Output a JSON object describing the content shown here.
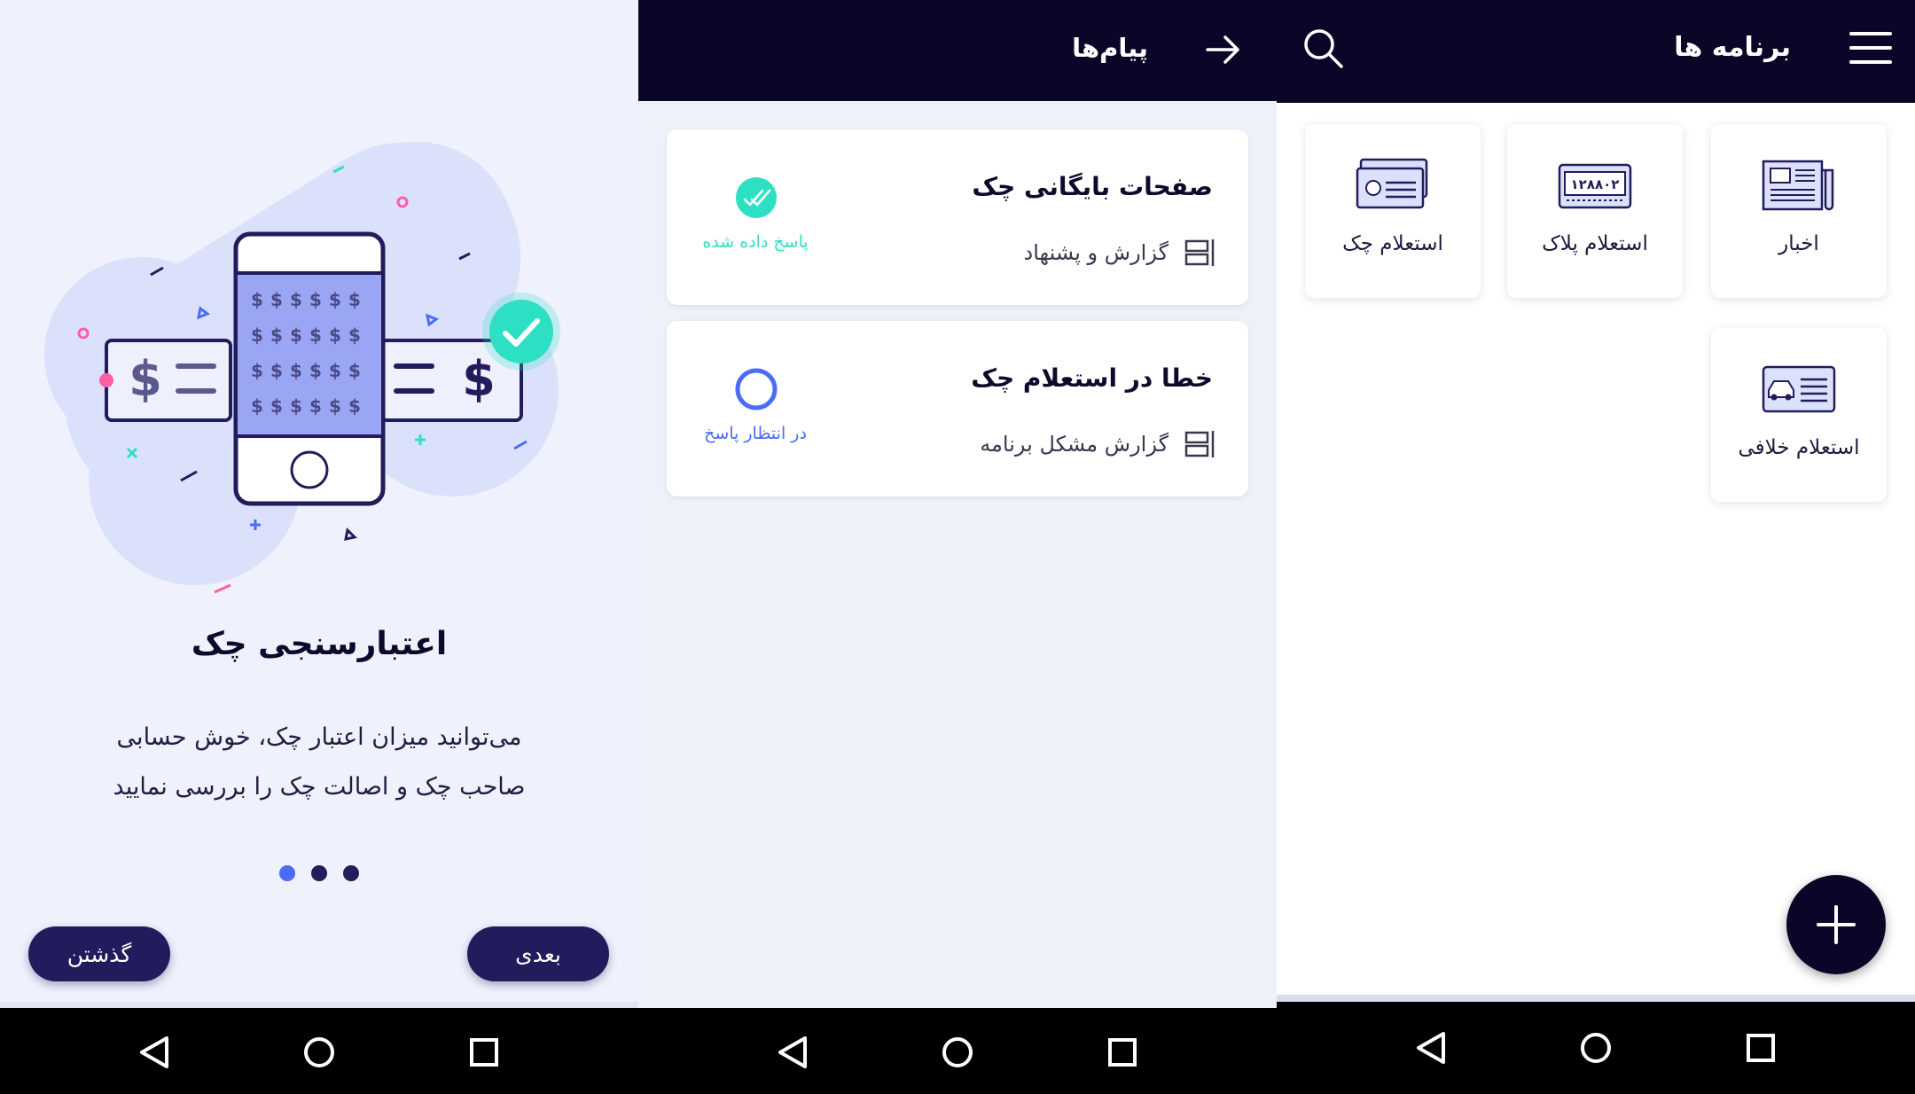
{
  "colors": {
    "navy": "#0a0628",
    "button": "#221b5c",
    "accent_teal": "#2ee0c3",
    "accent_blue": "#4a6cf7",
    "background_light": "#eff1fc"
  },
  "onboarding": {
    "title": "اعتبارسنجی چک",
    "description_line1": "می‌توانید میزان اعتبار چک، خوش حسابی",
    "description_line2": "صاحب چک و اصالت چک را بررسی نمایید",
    "pagination": {
      "total": 3,
      "active_index": 0
    },
    "skip_label": "گذشتن",
    "next_label": "بعدی",
    "illustration": {
      "symbol": "$"
    }
  },
  "messages": {
    "title": "پیام‌ها",
    "back_icon": "arrow-right-icon",
    "items": [
      {
        "title": "صفحات بایگانی چک",
        "category": "گزارش و پشنهاد",
        "status": "پاسخ داده شده",
        "status_icon": "double-check-icon",
        "status_color": "#2ee0c3"
      },
      {
        "title": "خطا در استعلام چک",
        "category": "گزارش مشکل برنامه",
        "status": "در انتظار پاسخ",
        "status_icon": "pending-circle-icon",
        "status_color": "#4a6cf7"
      }
    ]
  },
  "apps": {
    "title": "برنامه ها",
    "menu_icon": "hamburger-menu-icon",
    "search_icon": "search-icon",
    "items": [
      {
        "label": "اخبار",
        "icon": "newspaper-icon"
      },
      {
        "label": "استعلام پلاک",
        "icon": "license-plate-icon",
        "plate_text": "۱۲۸۸۰۲"
      },
      {
        "label": "استعلام چک",
        "icon": "cheque-icon"
      },
      {
        "label": "استعلام خلافی",
        "icon": "car-card-icon"
      }
    ],
    "fab_icon": "plus-icon"
  },
  "system_nav": {
    "back_icon": "triangle-back-icon",
    "home_icon": "circle-home-icon",
    "recents_icon": "square-recents-icon"
  }
}
